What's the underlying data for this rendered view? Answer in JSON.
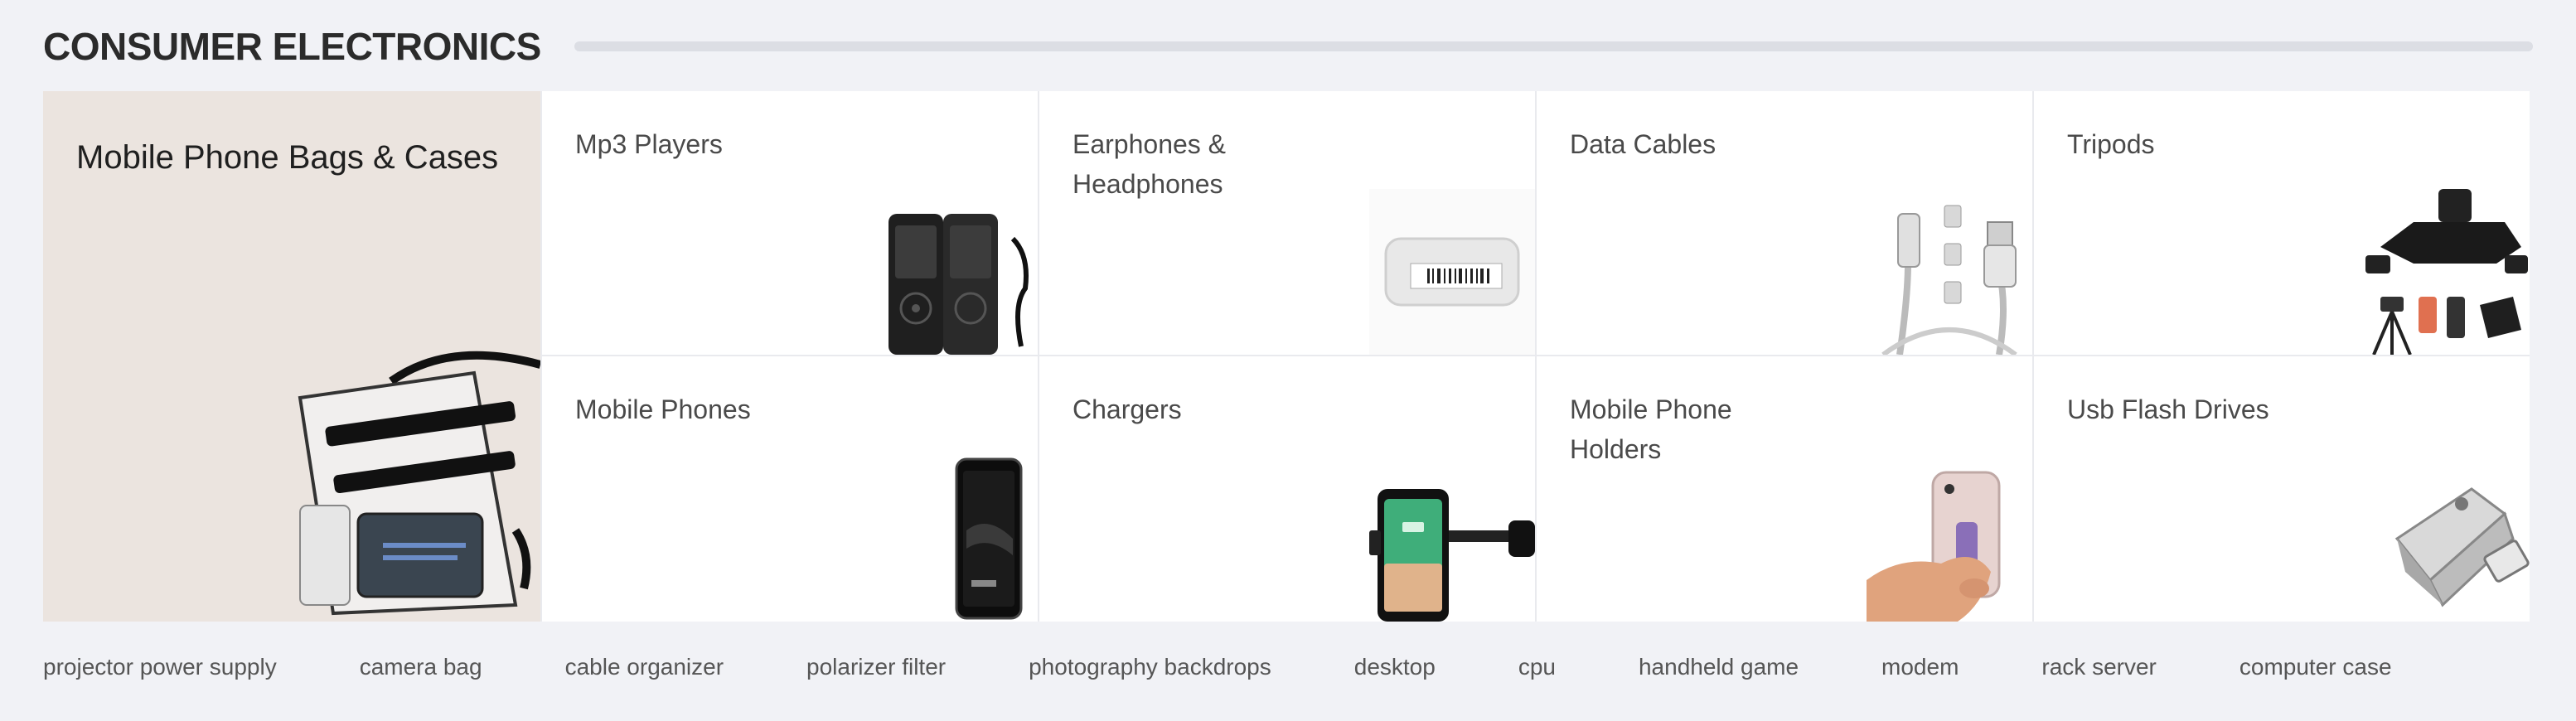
{
  "section": {
    "title": "CONSUMER ELECTRONICS"
  },
  "featured": {
    "label": "Mobile Phone Bags & Cases",
    "image_icon": "clear-phone-pouch-icon"
  },
  "categories": [
    {
      "label": "Mp3 Players",
      "image_icon": "mp3-player-icon"
    },
    {
      "label": "Earphones & Headphones",
      "image_icon": "earphone-package-icon"
    },
    {
      "label": "Data Cables",
      "image_icon": "usb-cable-icon"
    },
    {
      "label": "Tripods",
      "image_icon": "tripod-icon"
    },
    {
      "label": "Mobile Phones",
      "image_icon": "smartphone-icon"
    },
    {
      "label": "Chargers",
      "image_icon": "car-charger-mount-icon"
    },
    {
      "label": "Mobile Phone Holders",
      "image_icon": "phone-ring-holder-icon"
    },
    {
      "label": "Usb Flash Drives",
      "image_icon": "usb-flash-drive-icon"
    }
  ],
  "tags": [
    "projector power supply",
    "camera bag",
    "cable organizer",
    "polarizer filter",
    "photography backdrops",
    "desktop",
    "cpu",
    "handheld game",
    "modem",
    "rack server",
    "computer case"
  ],
  "colors": {
    "page_background": "#f1f2f6",
    "featured_background": "#ebe4df",
    "card_background": "#ffffff",
    "divider": "#e9eaee"
  }
}
